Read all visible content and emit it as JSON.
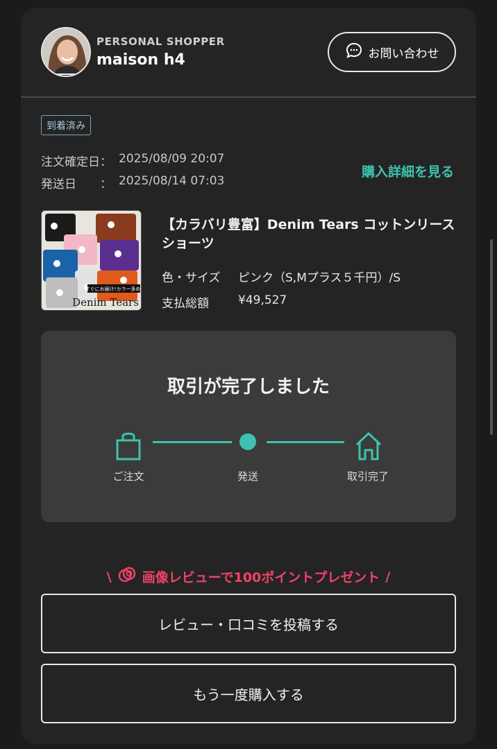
{
  "header": {
    "label": "PERSONAL SHOPPER",
    "shop_name": "maison h4",
    "contact_label": "お問い合わせ",
    "contact_icon": "chat-bubble-icon"
  },
  "order": {
    "status_badge": "到着済み",
    "confirmed_label": "注文確定日：",
    "confirmed_value": "2025/08/09 20:07",
    "shipped_label": "発送日　　：",
    "shipped_value": "2025/08/14 07:03",
    "detail_link": "購入詳細を見る"
  },
  "product": {
    "title": "【カラバリ豊富】Denim Tears コットンリースショーツ",
    "color_size_label": "色・サイズ",
    "color_size_value": "ピンク（S,Mプラス５千円）/S",
    "total_label": "支払総額",
    "total_value": "¥49,527",
    "thumb_text_banner": "すぐにお届け!カラー多め!",
    "thumb_text_brand": "Denim Tears"
  },
  "progress": {
    "title": "取引が完了しました",
    "steps": [
      {
        "label": "ご注文",
        "icon": "shopping-bag-icon"
      },
      {
        "label": "発送",
        "icon": "dot-icon"
      },
      {
        "label": "取引完了",
        "icon": "home-icon"
      }
    ],
    "accent": "#3ec2b0"
  },
  "review": {
    "promo_text": "画像レビューで100ポイントプレゼント",
    "promo_color": "#f0426b",
    "review_button": "レビュー・口コミを投稿する",
    "rebuy_button": "もう一度購入する"
  }
}
